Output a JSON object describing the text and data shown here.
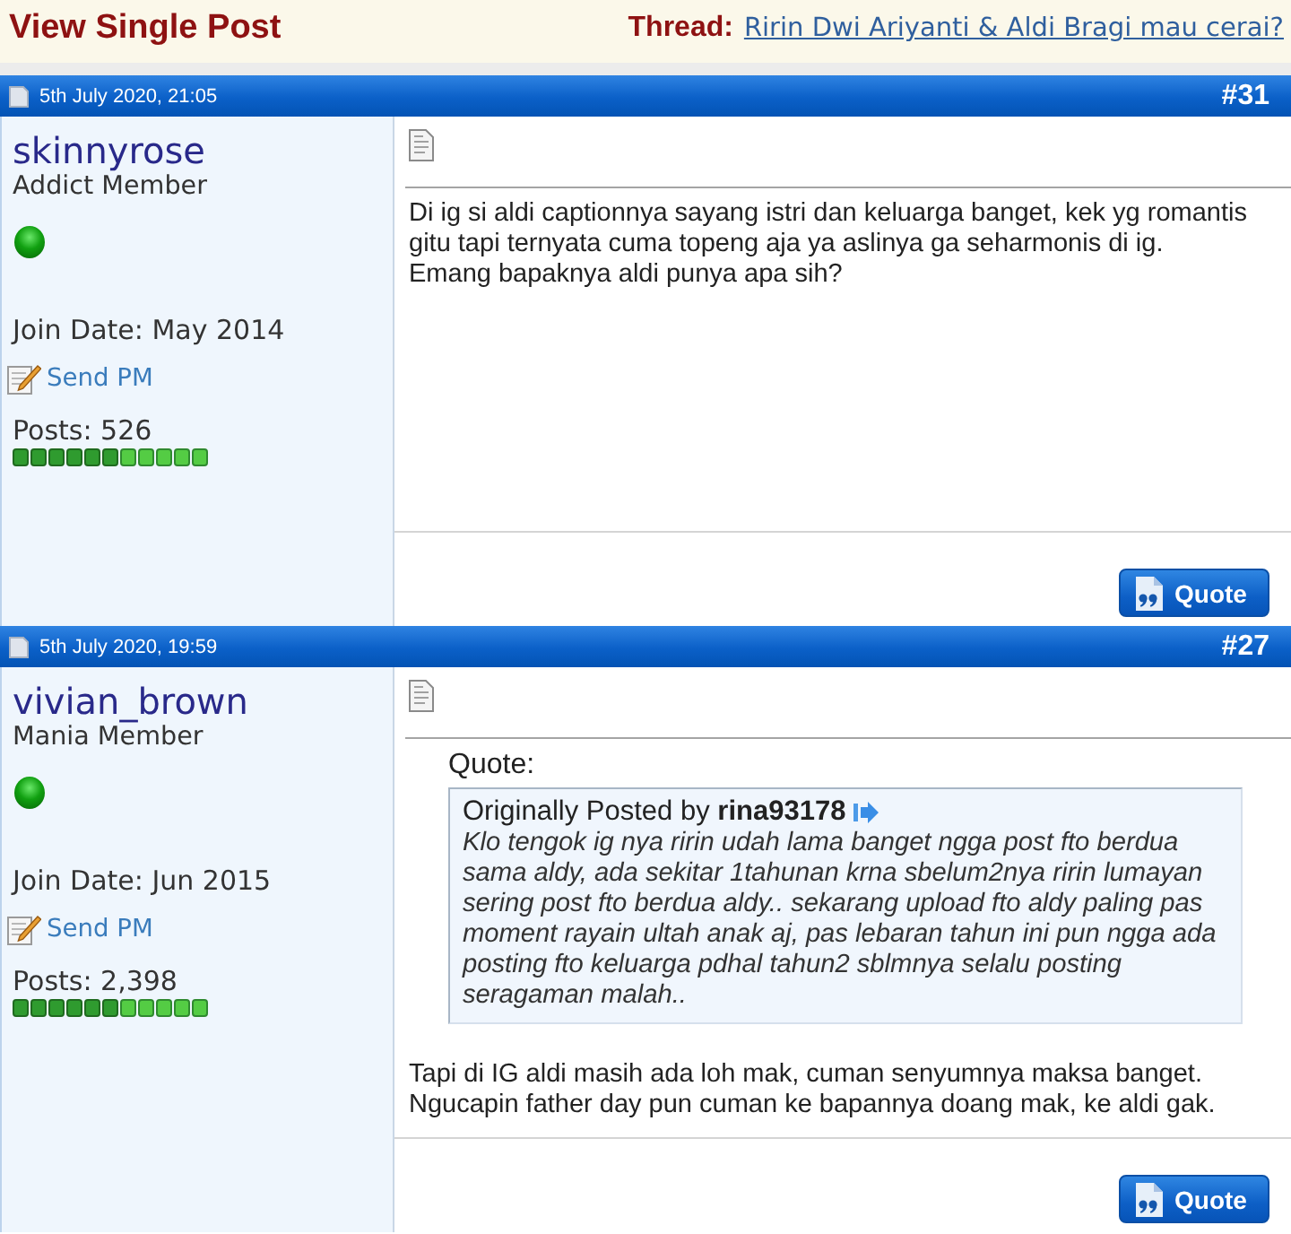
{
  "page_header": {
    "title": "View Single Post",
    "thread_label": "Thread:",
    "thread_title": "Ririn Dwi Ariyanti & Aldi Bragi mau cerai?"
  },
  "posts": [
    {
      "date": "5th July 2020, 21:05",
      "number": "#31",
      "user": {
        "name": "skinnyrose",
        "rank": "Addict Member",
        "online": true,
        "join_date": "Join Date: May 2014",
        "send_pm": "Send PM",
        "posts": "Posts: 526"
      },
      "message": "Di ig si aldi captionnya sayang istri dan keluarga banget, kek yg romantis gitu tapi ternyata cuma topeng aja ya aslinya ga seharmonis di ig.\nEmang bapaknya aldi punya apa sih?",
      "quote_button": "Quote"
    },
    {
      "date": "5th July 2020, 19:59",
      "number": "#27",
      "user": {
        "name": "vivian_brown",
        "rank": "Mania Member",
        "online": true,
        "join_date": "Join Date: Jun 2015",
        "send_pm": "Send PM",
        "posts": "Posts: 2,398"
      },
      "quote": {
        "heading": "Quote:",
        "attribution": "Originally Posted by **rina93178**",
        "text": "Klo tengok ig nya ririn udah lama banget ngga post fto berdua sama aldy, ada sekitar 1tahunan krna sbelum2nya ririn lumayan sering post fto berdua aldy.. sekarang upload fto aldy paling pas moment rayain ultah anak aj, pas lebaran tahun ini pun ngga ada posting fto keluarga pdhal tahun2 sblmnya selalu posting seragaman malah.."
      },
      "message": "Tapi di IG aldi masih ada loh mak, cuman senyumnya maksa banget.\nNgucapin father day pun cuman ke bapannya doang mak, ke aldi gak.",
      "quote_button": "Quote"
    }
  ]
}
